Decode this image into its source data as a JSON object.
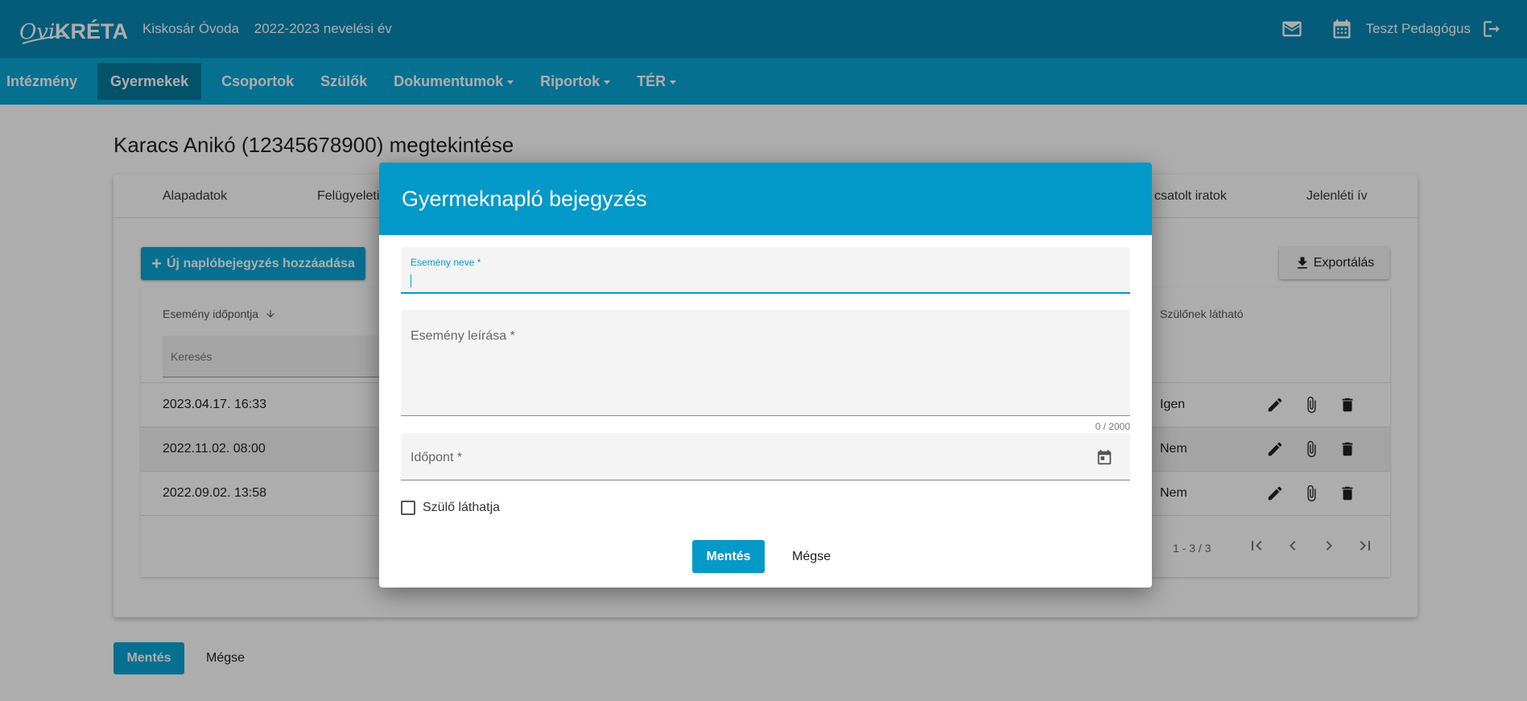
{
  "header": {
    "institution": "Kiskosár Óvoda",
    "year": "2022-2023 nevelési év",
    "user": "Teszt Pedagógus",
    "icons": [
      "mail-icon",
      "calendar-icon",
      "logout-icon"
    ]
  },
  "nav": {
    "items": [
      {
        "label": "Intézmény"
      },
      {
        "label": "Gyermekek"
      },
      {
        "label": "Csoportok"
      },
      {
        "label": "Szülők"
      },
      {
        "label": "Dokumentumok"
      },
      {
        "label": "Riportok"
      },
      {
        "label": "TÉR"
      }
    ],
    "active": "Gyermekek"
  },
  "page": {
    "title": "Karacs Anikó (12345678900) megtekintése",
    "tabs": [
      "Alapadatok",
      "Felügyeleti",
      "csatolt iratok",
      "Jelenléti ív"
    ],
    "new_entry_label": "Új naplóbejegyzés hozzáadása",
    "export_label": "Exportálás",
    "table": {
      "col_date": "Esemény időpontja",
      "col_visible": "Szülőnek látható",
      "search_placeholder": "Keresés",
      "rows": [
        {
          "date": "2023.04.17. 16:33",
          "visible": "Igen"
        },
        {
          "date": "2022.11.02. 08:00",
          "visible": "Nem"
        },
        {
          "date": "2022.09.02. 13:58",
          "visible": "Nem"
        }
      ],
      "pager": "1 - 3 / 3"
    },
    "save_label": "Mentés",
    "cancel_label": "Mégse"
  },
  "dialog": {
    "title": "Gyermeknapló bejegyzés",
    "event_name_label": "Esemény neve *",
    "event_desc_label": "Esemény leírása *",
    "counter": "0 / 2000",
    "time_label": "Időpont *",
    "checkbox_label": "Szülő láthatja",
    "save_label": "Mentés",
    "cancel_label": "Mégse"
  },
  "colors": {
    "topbar": "#0788b4",
    "navbar": "#0aa6d6",
    "accent": "#0399c8"
  }
}
